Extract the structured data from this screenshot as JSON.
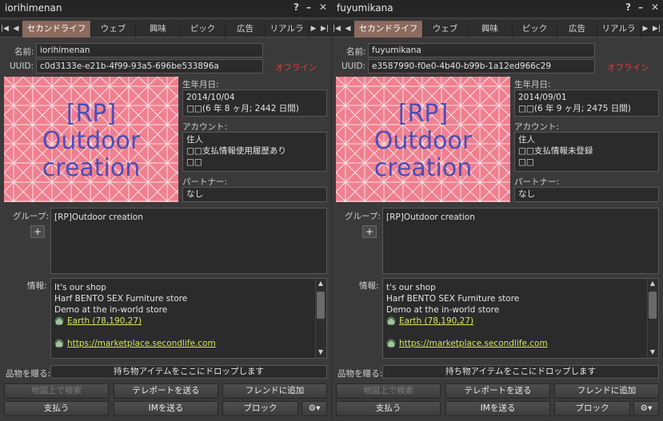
{
  "colors": {
    "accent_tab": "#8c6a5e",
    "offline": "#e04040",
    "link": "#d6e85a",
    "image_bg": "#f08090",
    "image_text": "#4a4fb8"
  },
  "profiles": [
    {
      "window_title": "iorihimenan",
      "controls": {
        "help": "?",
        "minimize": "–",
        "close": "✕"
      },
      "tabs": [
        "セカンドライフ",
        "ウェブ",
        "興味",
        "ピック",
        "広告",
        "リアルラ"
      ],
      "name_label": "名前:",
      "name": "iorihimenan",
      "uuid_label": "UUID:",
      "uuid": "c0d3133e-e21b-4f99-93a5-696be533896a",
      "status": "オフライン",
      "image_text": [
        "[RP]",
        "Outdoor",
        "creation"
      ],
      "birth_label": "生年月日:",
      "birth_date": "2014/10/04",
      "birth_age": "□□(6 年 8 ヶ月; 2442 日間)",
      "account_label": "アカウント:",
      "account_lines": [
        "住人",
        "□□支払情報使用履歴あり",
        "□□"
      ],
      "partner_label": "パートナー:",
      "partner": "なし",
      "groups_label": "グループ:",
      "groups": [
        "[RP]Outdoor creation"
      ],
      "add_group": "+",
      "info_label": "情報:",
      "info_lines": [
        "It's our shop",
        "Harf BENTO SEX Furniture store",
        "Demo at the in-world store"
      ],
      "info_link1": "Earth (78,190,27)",
      "info_link2": "https://marketplace.secondlife.com",
      "give_label": "品物を贈る:",
      "dropzone": "持ち物アイテムをここにドロップします",
      "buttons": {
        "map": "地図上で検索",
        "teleport": "テレポートを送る",
        "friend": "フレンドに追加",
        "pay": "支払う",
        "im": "IMを送る",
        "block": "ブロック",
        "gear": "⚙▾"
      }
    },
    {
      "window_title": "fuyumikana",
      "controls": {
        "help": "?",
        "minimize": "–",
        "close": "✕"
      },
      "tabs": [
        "セカンドライフ",
        "ウェブ",
        "興味",
        "ピック",
        "広告",
        "リアルラ"
      ],
      "name_label": "名前:",
      "name": "fuyumikana",
      "uuid_label": "UUID:",
      "uuid": "e3587990-f0e0-4b40-b99b-1a12ed966c29",
      "status": "オフライン",
      "image_text": [
        "[RP]",
        "Outdoor",
        "creation"
      ],
      "birth_label": "生年月日:",
      "birth_date": "2014/09/01",
      "birth_age": "□□(6 年 9 ヶ月; 2475 日間)",
      "account_label": "アカウント:",
      "account_lines": [
        "住人",
        "□□支払情報未登録",
        "□□"
      ],
      "partner_label": "パートナー:",
      "partner": "なし",
      "groups_label": "グループ:",
      "groups": [
        "[RP]Outdoor creation"
      ],
      "add_group": "+",
      "info_label": "情報:",
      "info_lines": [
        "t's our shop",
        "Harf BENTO SEX Furniture store",
        "Demo at the in-world store"
      ],
      "info_link1": "Earth (78,190,27)",
      "info_link2": "https://marketplace.secondlife.com",
      "give_label": "品物を贈る:",
      "dropzone": "持ち物アイテムをここにドロップします",
      "buttons": {
        "map": "地図上で検索",
        "teleport": "テレポートを送る",
        "friend": "フレンドに追加",
        "pay": "支払う",
        "im": "IMを送る",
        "block": "ブロック",
        "gear": "⚙▾"
      }
    }
  ]
}
